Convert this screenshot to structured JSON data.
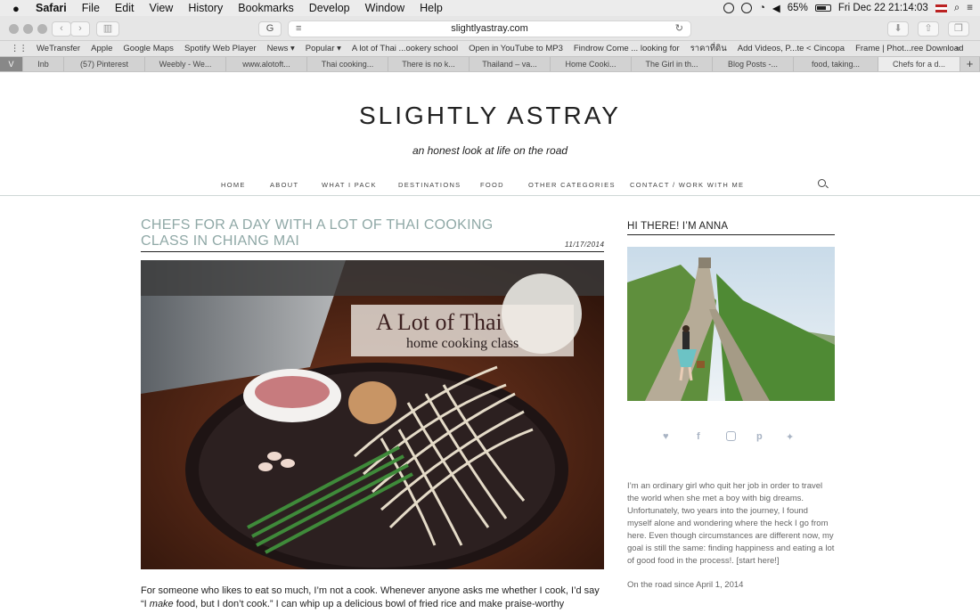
{
  "menubar": {
    "app": "Safari",
    "items": [
      "File",
      "Edit",
      "View",
      "History",
      "Bookmarks",
      "Develop",
      "Window",
      "Help"
    ],
    "battery": "65%",
    "datetime": "Fri Dec 22  21:14:03"
  },
  "toolbar": {
    "url": "slightlyastray.com"
  },
  "bookmarks": [
    "WeTransfer",
    "Apple",
    "Google Maps",
    "Spotify Web Player",
    "News ▾",
    "Popular ▾",
    "A lot of Thai ...ookery school",
    "Open in YouTube to MP3",
    "Findrow Come ... looking for",
    "ราคาที่ดิน",
    "Add Videos, P...te < Cincopa",
    "Frame | Phot...ree Download"
  ],
  "tabs": [
    "Inb",
    "(57) Pinterest",
    "Weebly - We...",
    "www.alotoft...",
    "Thai cooking...",
    "There is no k...",
    "Thailand – va...",
    "Home Cooki...",
    "The Girl in th...",
    "Blog Posts -...",
    "food, taking...",
    "Chefs for a d..."
  ],
  "site": {
    "title": "SLIGHTLY ASTRAY",
    "tagline": "an honest look at life on the road"
  },
  "nav": [
    "HOME",
    "ABOUT",
    "WHAT I PACK",
    "DESTINATIONS",
    "FOOD",
    "OTHER CATEGORIES",
    "CONTACT / WORK WITH ME"
  ],
  "post": {
    "title": "CHEFS FOR A DAY WITH A LOT OF THAI COOKING CLASS IN CHIANG MAI",
    "date": "11/17/2014",
    "photo_overlay_title": "A Lot of Thai",
    "photo_overlay_sub": "home cooking class",
    "body_line1": "For someone who likes to eat so much, I’m not a cook. Whenever anyone asks me whether I cook, I’d say",
    "body_line2_a": "“I ",
    "body_line2_em": "make",
    "body_line2_b": " food, but I don’t cook.” I can whip up a delicious bowl of fried rice and make praise-worthy guacamole,"
  },
  "sidebar": {
    "title": "HI THERE! I’M ANNA",
    "bio": "I’m an ordinary girl who quit her job in order to travel the world when she met a boy with big dreams. Unfortunately, two years into the journey, I found myself alone and wondering where the heck I go from here. Even though circumstances are different now, my goal is still the same: finding happiness and eating a lot of good food in the process!. [start here!]",
    "since": "On the road since April 1, 2014",
    "social_icons": [
      "heart-icon",
      "facebook-icon",
      "instagram-icon",
      "pinterest-icon",
      "twitter-icon"
    ]
  },
  "colors": {
    "accent": "#8fa8a6",
    "social": "#a9b4c4"
  }
}
